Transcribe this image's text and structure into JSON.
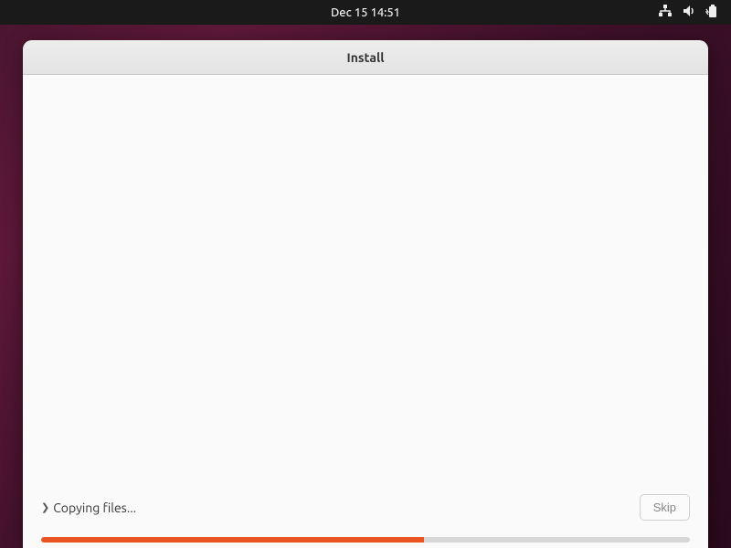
{
  "topbar": {
    "datetime": "Dec 15  14:51"
  },
  "window": {
    "title": "Install"
  },
  "installer": {
    "status_text": "Copying files...",
    "skip_label": "Skip",
    "progress_percent": 59
  }
}
